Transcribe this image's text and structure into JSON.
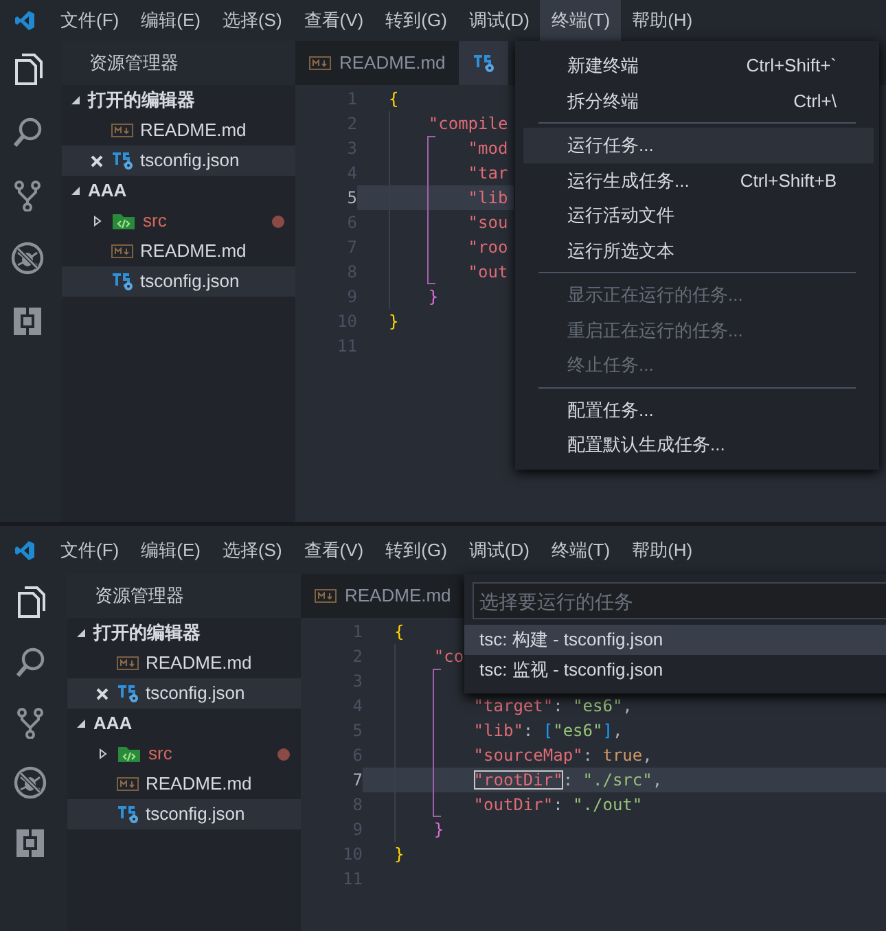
{
  "screens": [
    {
      "menu_bar": [
        {
          "label": "文件(F)",
          "selected": false
        },
        {
          "label": "编辑(E)",
          "selected": false
        },
        {
          "label": "选择(S)",
          "selected": false
        },
        {
          "label": "查看(V)",
          "selected": false
        },
        {
          "label": "转到(G)",
          "selected": false
        },
        {
          "label": "调试(D)",
          "selected": false
        },
        {
          "label": "终端(T)",
          "selected": true
        },
        {
          "label": "帮助(H)",
          "selected": false
        }
      ],
      "explorer": {
        "title": "资源管理器",
        "sections": [
          {
            "label": "打开的编辑器",
            "expanded": true,
            "items": [
              {
                "kind": "md",
                "label": "README.md",
                "selected": false,
                "modified": false,
                "closable": false
              },
              {
                "kind": "ts",
                "label": "tsconfig.json",
                "selected": true,
                "modified": false,
                "closable": true
              }
            ]
          },
          {
            "label": "AAA",
            "expanded": true,
            "items": [
              {
                "kind": "folder",
                "label": "src",
                "expanded": false,
                "selected": false,
                "modified": true,
                "closable": false
              },
              {
                "kind": "md",
                "label": "README.md",
                "selected": false,
                "modified": false,
                "closable": false
              },
              {
                "kind": "ts",
                "label": "tsconfig.json",
                "selected": true,
                "modified": false,
                "closable": false
              }
            ]
          }
        ]
      },
      "tabs": [
        {
          "kind": "md",
          "label": "README.md",
          "selected": false
        },
        {
          "kind": "ts",
          "selected": true
        }
      ],
      "lines": [
        {
          "number": "1",
          "current": false,
          "tokens": [
            {
              "kind": "bracket",
              "text": "{",
              "color": "#ffd700"
            }
          ]
        },
        {
          "number": "2",
          "current": false,
          "tokens": [
            {
              "kind": "key",
              "text": "    \"compile"
            }
          ]
        },
        {
          "number": "3",
          "current": false,
          "tokens": [
            {
              "kind": "key",
              "text": "        \"mod"
            }
          ]
        },
        {
          "number": "4",
          "current": false,
          "tokens": [
            {
              "kind": "key",
              "text": "        \"tar"
            }
          ]
        },
        {
          "number": "5",
          "current": true,
          "tokens": [
            {
              "kind": "key",
              "text": "        \"lib"
            }
          ]
        },
        {
          "number": "6",
          "current": false,
          "tokens": [
            {
              "kind": "key",
              "text": "        \"sou"
            }
          ]
        },
        {
          "number": "7",
          "current": false,
          "tokens": [
            {
              "kind": "key",
              "text": "        \"roo"
            }
          ]
        },
        {
          "number": "8",
          "current": false,
          "tokens": [
            {
              "kind": "key",
              "text": "        \"out"
            }
          ]
        },
        {
          "number": "9",
          "current": false,
          "tokens": [
            {
              "kind": "bracket",
              "text": "    }",
              "color": "#da70d6"
            }
          ]
        },
        {
          "number": "10",
          "current": false,
          "tokens": [
            {
              "kind": "bracket",
              "text": "}",
              "color": "#ffd700"
            }
          ]
        },
        {
          "number": "11",
          "current": false
        }
      ],
      "overlay": {
        "kind": "menu",
        "groups": [
          [
            {
              "label": "新建终端",
              "shortcut": "Ctrl+Shift+`",
              "disabled": false,
              "selected": false
            },
            {
              "label": "拆分终端",
              "shortcut": "Ctrl+\\",
              "disabled": false,
              "selected": false
            }
          ],
          [
            {
              "label": "运行任务...",
              "disabled": false,
              "selected": true
            },
            {
              "label": "运行生成任务...",
              "shortcut": "Ctrl+Shift+B",
              "disabled": false,
              "selected": false
            },
            {
              "label": "运行活动文件",
              "disabled": false,
              "selected": false
            },
            {
              "label": "运行所选文本",
              "disabled": false,
              "selected": false
            }
          ],
          [
            {
              "label": "显示正在运行的任务...",
              "disabled": true,
              "selected": false
            },
            {
              "label": "重启正在运行的任务...",
              "disabled": true,
              "selected": false
            },
            {
              "label": "终止任务...",
              "disabled": true,
              "selected": false
            }
          ],
          [
            {
              "label": "配置任务...",
              "disabled": false,
              "selected": false
            },
            {
              "label": "配置默认生成任务...",
              "disabled": false,
              "selected": false
            }
          ]
        ]
      }
    },
    {
      "menu_bar": [
        {
          "label": "文件(F)",
          "selected": false
        },
        {
          "label": "编辑(E)",
          "selected": false
        },
        {
          "label": "选择(S)",
          "selected": false
        },
        {
          "label": "查看(V)",
          "selected": false
        },
        {
          "label": "转到(G)",
          "selected": false
        },
        {
          "label": "调试(D)",
          "selected": false
        },
        {
          "label": "终端(T)",
          "selected": false
        },
        {
          "label": "帮助(H)",
          "selected": false
        }
      ],
      "explorer": {
        "title": "资源管理器",
        "sections": [
          {
            "label": "打开的编辑器",
            "expanded": true,
            "items": [
              {
                "kind": "md",
                "label": "README.md",
                "selected": false,
                "modified": false,
                "closable": false
              },
              {
                "kind": "ts",
                "label": "tsconfig.json",
                "selected": true,
                "modified": false,
                "closable": true
              }
            ]
          },
          {
            "label": "AAA",
            "expanded": true,
            "items": [
              {
                "kind": "folder",
                "label": "src",
                "expanded": false,
                "selected": false,
                "modified": true,
                "closable": false
              },
              {
                "kind": "md",
                "label": "README.md",
                "selected": false,
                "modified": false,
                "closable": false
              },
              {
                "kind": "ts",
                "label": "tsconfig.json",
                "selected": true,
                "modified": false,
                "closable": false
              }
            ]
          }
        ]
      },
      "tabs": [
        {
          "kind": "md",
          "label": "README.md",
          "selected": false
        }
      ],
      "lines": [
        {
          "number": "1",
          "current": false,
          "tokens": [
            {
              "kind": "bracket",
              "text": "{",
              "color": "#ffd700"
            }
          ]
        },
        {
          "number": "2",
          "current": false,
          "tokens": [
            {
              "kind": "key",
              "text": "    \"co"
            }
          ]
        },
        {
          "number": "3",
          "current": false
        },
        {
          "number": "4",
          "current": false,
          "tokens": [
            {
              "kind": "key",
              "text": "        \"target\""
            },
            {
              "kind": "punct",
              "text": ": "
            },
            {
              "kind": "string",
              "text": "\"es6\""
            },
            {
              "kind": "punct",
              "text": ","
            }
          ]
        },
        {
          "number": "5",
          "current": false,
          "tokens": [
            {
              "kind": "key",
              "text": "        \"lib\""
            },
            {
              "kind": "punct",
              "text": ": "
            },
            {
              "kind": "bracket",
              "text": "[",
              "color": "#179fff"
            },
            {
              "kind": "string",
              "text": "\"es6\""
            },
            {
              "kind": "bracket",
              "text": "]",
              "color": "#179fff"
            },
            {
              "kind": "punct",
              "text": ","
            }
          ]
        },
        {
          "number": "6",
          "current": false,
          "tokens": [
            {
              "kind": "key",
              "text": "        \"sourceMap\""
            },
            {
              "kind": "punct",
              "text": ": "
            },
            {
              "kind": "bool",
              "text": "true"
            },
            {
              "kind": "punct",
              "text": ","
            }
          ]
        },
        {
          "number": "7",
          "current": true,
          "tokens": [
            {
              "kind": "key",
              "text": "        \"rootDir\"",
              "boxed": true
            },
            {
              "kind": "punct",
              "text": ": "
            },
            {
              "kind": "string",
              "text": "\"./src\""
            },
            {
              "kind": "punct",
              "text": ","
            }
          ]
        },
        {
          "number": "8",
          "current": false,
          "tokens": [
            {
              "kind": "key",
              "text": "        \"outDir\""
            },
            {
              "kind": "punct",
              "text": ": "
            },
            {
              "kind": "string",
              "text": "\"./out\""
            }
          ]
        },
        {
          "number": "9",
          "current": false,
          "tokens": [
            {
              "kind": "bracket",
              "text": "    }",
              "color": "#da70d6"
            }
          ]
        },
        {
          "number": "10",
          "current": false,
          "tokens": [
            {
              "kind": "bracket",
              "text": "}",
              "color": "#ffd700"
            }
          ]
        },
        {
          "number": "11",
          "current": false
        }
      ],
      "overlay": {
        "kind": "quick_pick",
        "placeholder": "选择要运行的任务",
        "items": [
          {
            "label": "tsc: 构建 - tsconfig.json",
            "selected": true
          },
          {
            "label": "tsc: 监视 - tsconfig.json",
            "selected": false
          }
        ]
      }
    }
  ]
}
